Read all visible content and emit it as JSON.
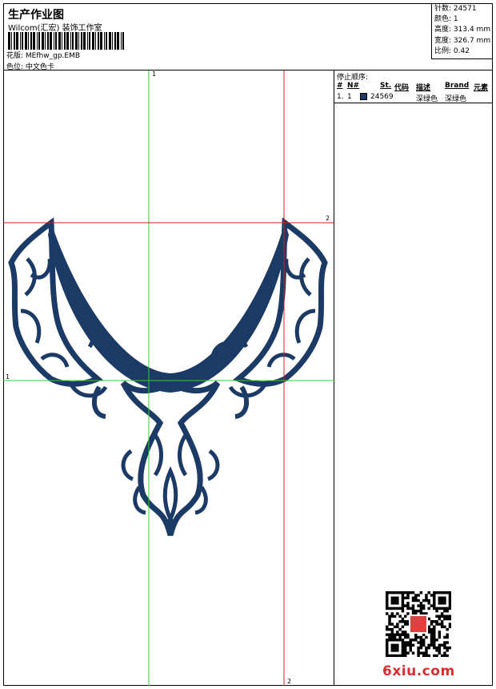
{
  "header": {
    "title": "生产作业图",
    "company": "Wilcom(汇宏) 装饰工作室",
    "file_label": "花版:",
    "file_value": "MEfhw_gp.EMB",
    "color_label": "色位:",
    "color_value": "中文色卡"
  },
  "specs": [
    {
      "label": "针数:",
      "value": "24571"
    },
    {
      "label": "颜色:",
      "value": "1"
    },
    {
      "label": "高度:",
      "value": "313.4 mm"
    },
    {
      "label": "宽度:",
      "value": "326.7 mm"
    },
    {
      "label": "比例:",
      "value": "0.42"
    }
  ],
  "stop_sequence": {
    "title": "停止顺序:",
    "columns": [
      "#",
      "N#",
      "St.",
      "代码",
      "描述",
      "Brand",
      "元素"
    ],
    "rows": [
      {
        "index": "1.",
        "needle": "1",
        "stitches": "24569",
        "code": "",
        "description": "深绿色",
        "brand": "深绿色",
        "swatch_color": "#1b3a66"
      }
    ]
  },
  "guides": {
    "vertical_1": "1",
    "vertical_2": "2",
    "horizontal_1": "1",
    "horizontal_2": "2"
  },
  "design": {
    "thread_color": "#1b3a66",
    "guide_green": "#33cc33",
    "guide_red": "#cc2222"
  },
  "watermark": "6xiu.com"
}
